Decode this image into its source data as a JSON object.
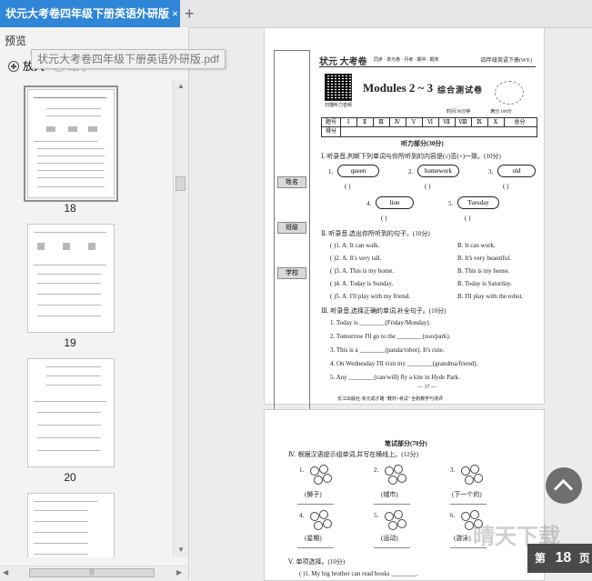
{
  "tab": {
    "title": "状元大考卷四年级下册英语外研版",
    "close": "×",
    "new": "+"
  },
  "tooltip": "状元大考卷四年级下册英语外研版.pdf",
  "sidebar": {
    "title": "预览",
    "zoom_in": "放大",
    "zoom_out": "缩小",
    "pages": [
      "18",
      "19",
      "20"
    ]
  },
  "hscroll_grip": "|||",
  "page17": {
    "header_words": "同步 · 单元卷 · 月考 · 期中 · 期末",
    "grade": "四年级英语下册(WY)",
    "title": "Modules 2 ~ 3",
    "subtitle": "综合测试卷",
    "qr_caption": "扫描听力音频",
    "time": "时间:90分钟",
    "score": "满分:100分",
    "table_row1": [
      "题号",
      "Ⅰ",
      "Ⅱ",
      "Ⅲ",
      "Ⅳ",
      "Ⅴ",
      "Ⅵ",
      "Ⅶ",
      "Ⅷ",
      "Ⅸ",
      "Ⅹ",
      "总分"
    ],
    "table_row2_label": "得分",
    "strip_labels": [
      "姓名",
      "班级",
      "学校"
    ],
    "listening": "听力部分(30分)",
    "q1": "Ⅰ. 听录音,判断下列单词与你所听到的内容是(√)否(×)一致。(10分)",
    "q1_words": [
      "queen",
      "homework",
      "old",
      "lion",
      "Tuesday"
    ],
    "q1_nums": [
      "1.",
      "2.",
      "3.",
      "4.",
      "5."
    ],
    "paren": "(      )",
    "q2": "Ⅱ. 听录音,选出你所听到的句子。(10分)",
    "q2_rows": [
      [
        "(    )1. A. It can walk.",
        "B. It can work."
      ],
      [
        "(    )2. A. It's very tall.",
        "B. It's very beautiful."
      ],
      [
        "(    )3. A. This is my home.",
        "B. This is my house."
      ],
      [
        "(    )4. A. Today is Sunday.",
        "B. Today is Saturday."
      ],
      [
        "(    )5. A. I'll play with my friend.",
        "B. I'll play with the robot."
      ]
    ],
    "q3": "Ⅲ. 听录音,选择正确的单词,补全句子。(10分)",
    "q3_rows": [
      "1. Today is ________(Friday/Monday).",
      "2. Tomorrow I'll go to the ________(zoo/park).",
      "3. This is a ________(panda/robot). It's cute.",
      "4. On Wednesday I'll visit my ________(grandma/friend).",
      "5. Any ________(can/will) fly a kite in Hyde Park."
    ],
    "page_num": "— 17 —",
    "footer": "长江出版社·状元成才路 \"教材+考试\" 全新教学与测评"
  },
  "page18": {
    "written": "笔试部分(70分)",
    "q4": "Ⅳ. 根据汉语提示组单词,并写在横线上。(12分)",
    "q4_nums": [
      "1.",
      "2.",
      "3.",
      "4.",
      "5.",
      "6."
    ],
    "q4_hints": [
      "(狮子)",
      "(城市)",
      "(下一个的)",
      "(星期)",
      "(运动)",
      "(游泳)"
    ],
    "q5": "Ⅴ. 单项选择。(10分)",
    "q5_row1": "(    )1. My big brother can read books ________."
  },
  "page_badge": {
    "label": "第",
    "number": "18",
    "suffix": "页"
  },
  "watermark": "晴天下载"
}
